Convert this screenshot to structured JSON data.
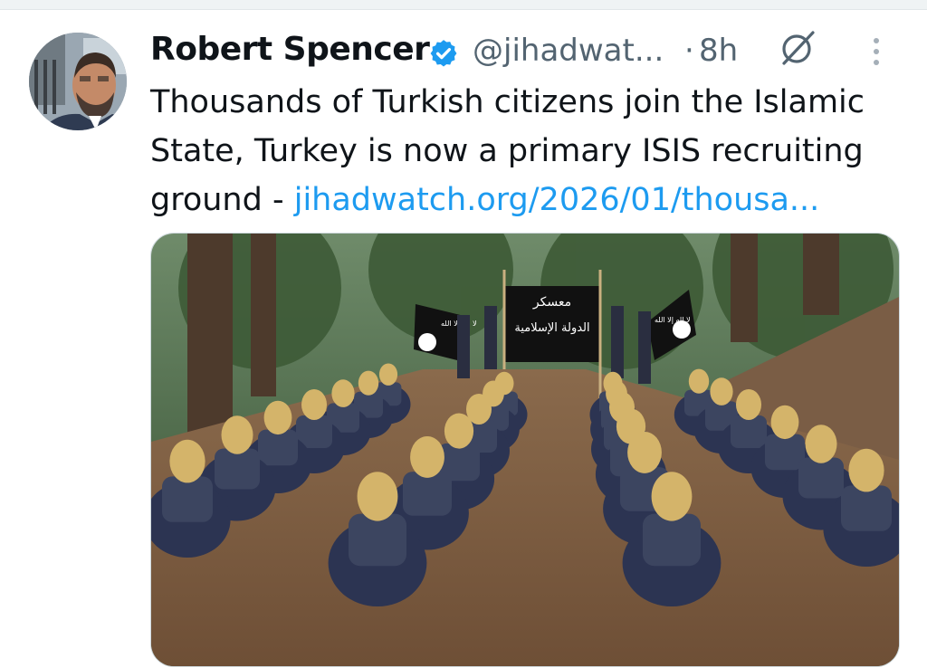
{
  "tweet": {
    "author_name": "Robert Spencer",
    "handle": "@jihadwat...",
    "separator": "·",
    "time": "8h",
    "text_line1": "Thousands of Turkish citizens join the Islamic",
    "text_line2": "State, Turkey is now a primary ISIS recruiting",
    "text_line3_prefix": "ground - ",
    "link_text": "jihadwatch.org/2026/01/thousa...",
    "flag_left_text": "ﻻ إله إلا الله",
    "banner_top": "معسكر",
    "banner_main": "الدولة الإسلامية",
    "flag_right_text": "ﻻ إله إلا الله"
  },
  "icons": {
    "verified": "verified-badge-icon",
    "grok": "grok-icon",
    "more": "more-vertical-icon"
  },
  "colors": {
    "link": "#1d9bf0",
    "verified": "#1d9bf0",
    "text": "#0f1419",
    "secondary": "#536471"
  }
}
